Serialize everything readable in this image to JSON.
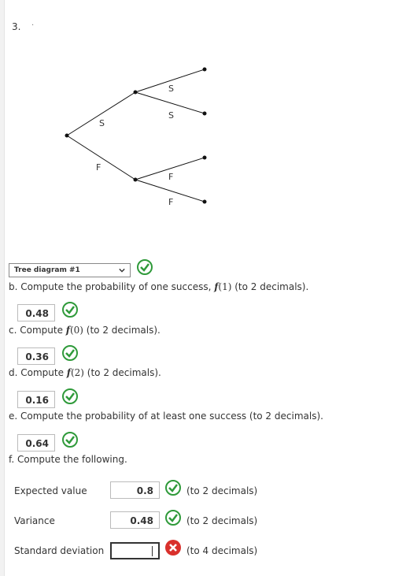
{
  "question_number": "3.",
  "tree": {
    "branch_labels": [
      "S",
      "F",
      "S",
      "S",
      "F",
      "F"
    ]
  },
  "select": {
    "value": "Tree diagram #1"
  },
  "parts": {
    "b": {
      "prefix": "b. Compute the probability of one success,",
      "fn": "f",
      "arg": "(1)",
      "suffix": "(to 2 decimals).",
      "answer": "0.48"
    },
    "c": {
      "prefix": "c. Compute",
      "fn": "f",
      "arg": "(0)",
      "suffix": "(to 2 decimals).",
      "answer": "0.36"
    },
    "d": {
      "prefix": "d. Compute",
      "fn": "f",
      "arg": "(2)",
      "suffix": "(to 2 decimals).",
      "answer": "0.16"
    },
    "e": {
      "text": "e. Compute the probability of at least one success (to 2 decimals).",
      "answer": "0.64"
    },
    "f": {
      "text": "f. Compute the following."
    }
  },
  "rows": [
    {
      "label": "Expected value",
      "value": "0.8",
      "hint": "(to 2 decimals)",
      "status": "correct"
    },
    {
      "label": "Variance",
      "value": "0.48",
      "hint": "(to 2 decimals)",
      "status": "correct"
    },
    {
      "label": "Standard deviation",
      "value": "",
      "hint": "(to 4 decimals)",
      "status": "incorrect"
    }
  ],
  "colors": {
    "correct": "#2f9a3a",
    "incorrect": "#d9302c"
  },
  "icons": {
    "correct": "check-circle-icon",
    "incorrect": "x-circle-icon",
    "dropdown": "chevron-down-icon"
  }
}
